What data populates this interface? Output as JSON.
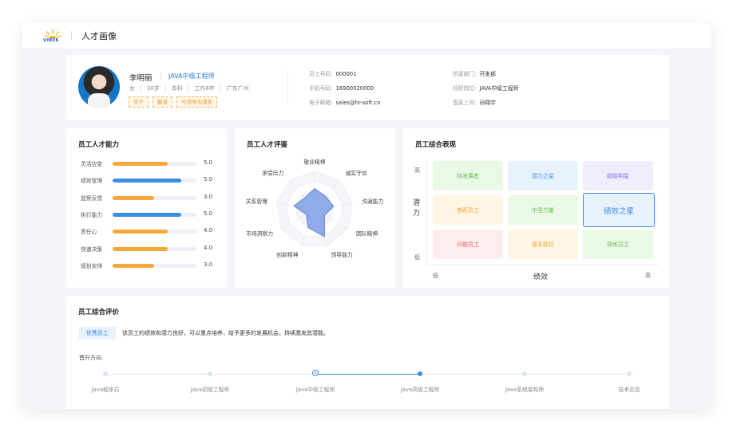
{
  "header": {
    "logo_text": "VHEEK",
    "title": "人才画像"
  },
  "profile": {
    "name": "李明丽",
    "position": "JAVA中级工程师",
    "meta": [
      "女",
      "30岁",
      "本科",
      "工作8年",
      "广东广州"
    ],
    "tags": [
      "实干",
      "触显",
      "与领导沟通多"
    ],
    "info_left": [
      {
        "label": "员工号码:",
        "value": "000001"
      },
      {
        "label": "手机号码:",
        "value": "16900020000"
      },
      {
        "label": "电子邮箱:",
        "value": "sales@hr-soft.cn"
      }
    ],
    "info_right": [
      {
        "label": "所属部门:",
        "value": "开发部"
      },
      {
        "label": "任职岗位:",
        "value": "JAVA中级工程师"
      },
      {
        "label": "直属上司:",
        "value": "孙翔宇"
      }
    ]
  },
  "ability": {
    "title": "员工人才能力",
    "items": [
      {
        "label": "灵活应变",
        "value": "5.0",
        "level": 0.8,
        "color": "#f5a83a"
      },
      {
        "label": "绩效管理",
        "value": "5.0",
        "level": 1.0,
        "color": "#3a8ee6"
      },
      {
        "label": "监察反馈",
        "value": "3.0",
        "level": 0.6,
        "color": "#f5a83a"
      },
      {
        "label": "执行能力",
        "value": "5.0",
        "level": 1.0,
        "color": "#3a8ee6"
      },
      {
        "label": "责任心",
        "value": "4.0",
        "level": 0.8,
        "color": "#f5a83a"
      },
      {
        "label": "快速决策",
        "value": "4.0",
        "level": 0.8,
        "color": "#f5a83a"
      },
      {
        "label": "规划安排",
        "value": "3.0",
        "level": 0.6,
        "color": "#f5a83a"
      }
    ]
  },
  "radar": {
    "title": "员工人才评鉴",
    "axes": [
      "敬业精神",
      "诚实守信",
      "沟通能力",
      "团队精神",
      "领导能力",
      "创新精神",
      "市场洞察力",
      "关系管理",
      "承受压力"
    ],
    "values": [
      0.55,
      0.45,
      0.5,
      0.3,
      0.75,
      0.5,
      0.25,
      0.55,
      0.4
    ],
    "fill": "#7f9ee6",
    "stroke": "#4c6fd1"
  },
  "performance": {
    "title": "员工综合表现",
    "y_axis": {
      "high": "高",
      "label": "潜力",
      "low": "低"
    },
    "x_axis": {
      "low": "低",
      "label": "绩效",
      "high": "高"
    },
    "grid": [
      [
        {
          "label": "待发展者",
          "bg": "#eaf8e6",
          "fg": "#6bbf5a"
        },
        {
          "label": "潜力之星",
          "bg": "#e7f2fd",
          "fg": "#3a8ee6"
        },
        {
          "label": "超级明星",
          "bg": "#f0edfc",
          "fg": "#8a6ee0"
        }
      ],
      [
        {
          "label": "差距员工",
          "bg": "#fff5e4",
          "fg": "#f0a436"
        },
        {
          "label": "中坚力量",
          "bg": "#eaf8e6",
          "fg": "#6bbf5a"
        },
        {
          "label": "绩效之星",
          "bg": "#e7f2fd",
          "fg": "#3a8ee6",
          "selected": true
        }
      ],
      [
        {
          "label": "问题员工",
          "bg": "#fdeeee",
          "fg": "#e8605c"
        },
        {
          "label": "基本胜任",
          "bg": "#fff5e4",
          "fg": "#f0a436"
        },
        {
          "label": "熟练员工",
          "bg": "#eaf8e6",
          "fg": "#6bbf5a"
        }
      ]
    ]
  },
  "evaluation": {
    "title": "员工综合评价",
    "badge": "优秀员工",
    "text": "该员工的绩效和潜力良好，可以重点培养，给予更多的发展机会，持续激发其潜能。",
    "promotion_label": "晋升方向:",
    "timeline": [
      {
        "label": "Java程序员",
        "state": "future"
      },
      {
        "label": "Java初级工程师",
        "state": "future"
      },
      {
        "label": "Java中级工程师",
        "state": "current"
      },
      {
        "label": "Java高级工程师",
        "state": "next"
      },
      {
        "label": "Java系统架构师",
        "state": "future"
      },
      {
        "label": "技术总监",
        "state": "future"
      }
    ]
  }
}
